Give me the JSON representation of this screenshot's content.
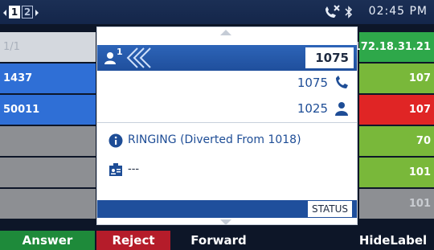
{
  "status_bar": {
    "page1": "1",
    "page2": "2",
    "time": "02:45 PM"
  },
  "left_column": [
    {
      "label": "1/1",
      "color": "#d4d8de",
      "text_color": "#a9b0bb"
    },
    {
      "label": "1437",
      "color": "#2f6fd6",
      "text_color": "#ffffff"
    },
    {
      "label": "50011",
      "color": "#2f6fd6",
      "text_color": "#ffffff"
    },
    {
      "label": "",
      "color": "#8d8f93"
    },
    {
      "label": "",
      "color": "#8d8f93"
    },
    {
      "label": "",
      "color": "#8d8f93"
    }
  ],
  "right_column": [
    {
      "label": "172.18.31.21",
      "color": "#2ea84a"
    },
    {
      "label": "107",
      "color": "#79b83a"
    },
    {
      "label": "107",
      "color": "#e02525"
    },
    {
      "label": "70",
      "color": "#79b83a"
    },
    {
      "label": "101",
      "color": "#79b83a"
    },
    {
      "label": "101",
      "color": "#8d8f93"
    }
  ],
  "popup": {
    "line_number": "1",
    "header_number": "1075",
    "number_line2": "1075",
    "number_line3": "1025",
    "status_message": "RINGING (Diverted From 1018)",
    "detail_value": "---",
    "status_button": "STATUS"
  },
  "softkeys": [
    {
      "label": "Answer",
      "color": "#1e8a3a"
    },
    {
      "label": "Reject",
      "color": "#b51c2a"
    },
    {
      "label": "Forward",
      "color": "#0d1628"
    },
    {
      "label": "HideLabel",
      "color": "#0d1628"
    }
  ],
  "colors": {
    "accent": "#1f4f9c",
    "background": "#0d1628"
  }
}
